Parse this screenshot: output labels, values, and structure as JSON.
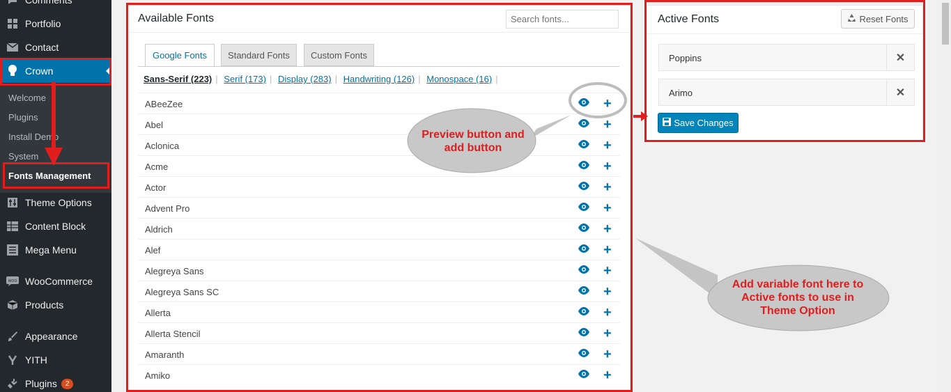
{
  "sidebar": {
    "items": [
      {
        "label": "Comments",
        "icon": "comments-icon"
      },
      {
        "label": "Portfolio",
        "icon": "grid-icon"
      },
      {
        "label": "Contact",
        "icon": "envelope-icon"
      },
      {
        "label": "Crown",
        "icon": "lightbulb-icon"
      },
      {
        "label": "Theme Options",
        "icon": "options-icon"
      },
      {
        "label": "Content Block",
        "icon": "table-icon"
      },
      {
        "label": "Mega Menu",
        "icon": "list-icon"
      },
      {
        "label": "WooCommerce",
        "icon": "woo-icon"
      },
      {
        "label": "Products",
        "icon": "box-icon"
      },
      {
        "label": "Appearance",
        "icon": "brush-icon"
      },
      {
        "label": "YITH",
        "icon": "yith-icon"
      },
      {
        "label": "Plugins",
        "icon": "plug-icon",
        "badge": "2"
      }
    ],
    "submenu": [
      "Welcome",
      "Plugins",
      "Install Demo",
      "System",
      "Fonts Management"
    ]
  },
  "available": {
    "title": "Available Fonts",
    "search_placeholder": "Search fonts...",
    "tabs": [
      "Google Fonts",
      "Standard Fonts",
      "Custom Fonts"
    ],
    "categories": [
      "Sans-Serif (223)",
      "Serif (173)",
      "Display (283)",
      "Handwriting (126)",
      "Monospace (16)"
    ],
    "fonts": [
      "ABeeZee",
      "Abel",
      "Aclonica",
      "Acme",
      "Actor",
      "Advent Pro",
      "Aldrich",
      "Alef",
      "Alegreya Sans",
      "Alegreya Sans SC",
      "Allerta",
      "Allerta Stencil",
      "Amaranth",
      "Amiko"
    ]
  },
  "active": {
    "title": "Active Fonts",
    "reset_label": "Reset Fonts",
    "fonts": [
      "Poppins",
      "Arimo"
    ],
    "save_label": "Save Changes"
  },
  "annotations": {
    "preview_callout": "Preview button and add button",
    "add_callout": "Add variable font here to Active fonts to use in Theme Option"
  },
  "colors": {
    "accent": "#0073aa",
    "sidebar_bg": "#23282d",
    "annotation_red": "#e01e1e"
  }
}
